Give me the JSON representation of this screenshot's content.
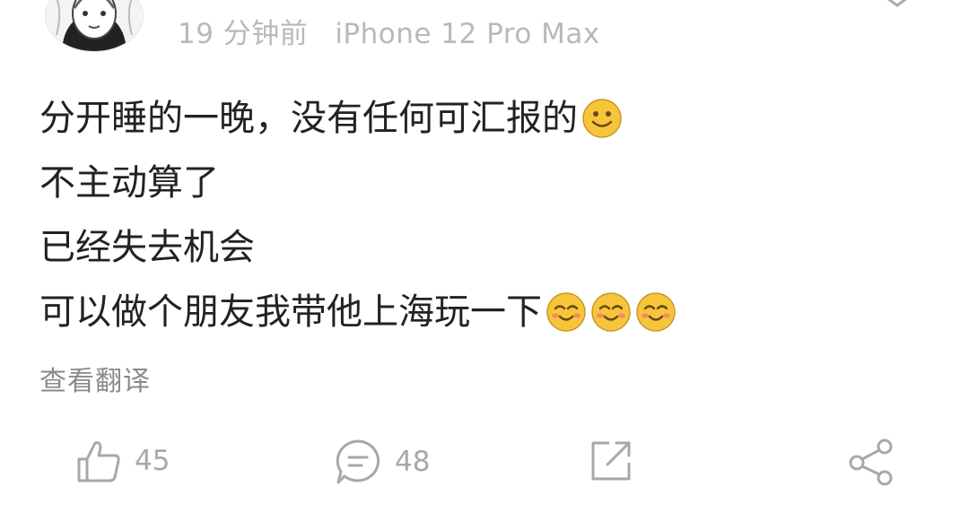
{
  "post": {
    "time": "19 分钟前",
    "device": "iPhone 12 Pro Max",
    "lines": [
      {
        "text": "分开睡的一晚，没有任何可汇报的",
        "emojis": [
          "smile-emoji"
        ]
      },
      {
        "text": "不主动算了",
        "emojis": []
      },
      {
        "text": "已经失去机会",
        "emojis": []
      },
      {
        "text": "可以做个朋友我带他上海玩一下",
        "emojis": [
          "blush-emoji",
          "blush-emoji",
          "blush-emoji"
        ]
      }
    ],
    "translate_label": "查看翻译"
  },
  "actions": {
    "likes": "45",
    "comments": "48"
  },
  "icons": [
    "more-chevron-icon",
    "thumbs-up-icon",
    "comment-icon",
    "repost-icon",
    "share-icon"
  ],
  "colors": {
    "text": "#222222",
    "meta": "#b9b9b9",
    "icon": "#a8a8a8",
    "emoji": "#f8c53a"
  }
}
